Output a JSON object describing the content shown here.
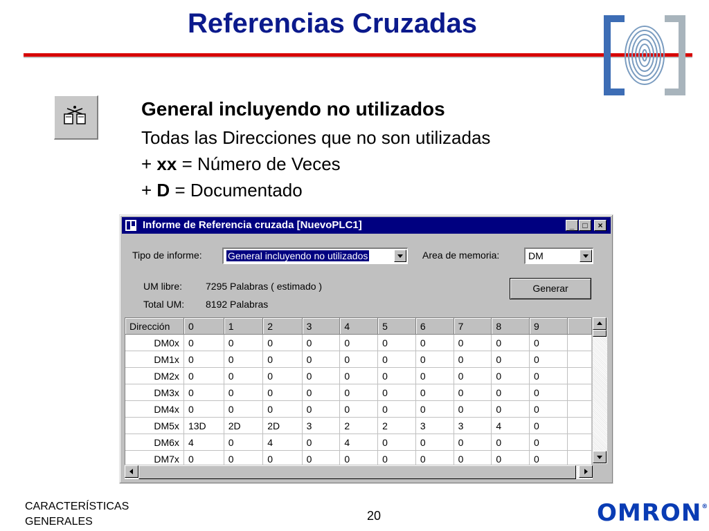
{
  "slide": {
    "title": "Referencias Cruzadas",
    "heading": "General incluyendo no utilizados",
    "line1": "Todas las Direcciones que no son utilizadas",
    "line2_prefix": "+",
    "line2_bold": "xx",
    "line2_rest": "= Número de Veces",
    "line3_prefix": "+",
    "line3_bold": "D",
    "line3_rest": "= Documentado"
  },
  "window": {
    "title": "Informe de Referencia cruzada [NuevoPLC1]",
    "report_type_label": "Tipo de informe:",
    "report_type_value": "General incluyendo no utilizados",
    "memory_area_label": "Area de memoria:",
    "memory_area_value": "DM",
    "um_free_label": "UM libre:",
    "um_free_value": "7295 Palabras ( estimado )",
    "um_total_label": "Total UM:",
    "um_total_value": "8192 Palabras",
    "generate_label": "Generar"
  },
  "table": {
    "headers": [
      "Dirección",
      "0",
      "1",
      "2",
      "3",
      "4",
      "5",
      "6",
      "7",
      "8",
      "9"
    ],
    "rows": [
      [
        "DM0x",
        "0",
        "0",
        "0",
        "0",
        "0",
        "0",
        "0",
        "0",
        "0",
        "0"
      ],
      [
        "DM1x",
        "0",
        "0",
        "0",
        "0",
        "0",
        "0",
        "0",
        "0",
        "0",
        "0"
      ],
      [
        "DM2x",
        "0",
        "0",
        "0",
        "0",
        "0",
        "0",
        "0",
        "0",
        "0",
        "0"
      ],
      [
        "DM3x",
        "0",
        "0",
        "0",
        "0",
        "0",
        "0",
        "0",
        "0",
        "0",
        "0"
      ],
      [
        "DM4x",
        "0",
        "0",
        "0",
        "0",
        "0",
        "0",
        "0",
        "0",
        "0",
        "0"
      ],
      [
        "DM5x",
        "13D",
        "2D",
        "2D",
        "3",
        "2",
        "2",
        "3",
        "3",
        "4",
        "0"
      ],
      [
        "DM6x",
        "4",
        "0",
        "4",
        "0",
        "4",
        "0",
        "0",
        "0",
        "0",
        "0"
      ],
      [
        "DM7x",
        "0",
        "0",
        "0",
        "0",
        "0",
        "0",
        "0",
        "0",
        "0",
        "0"
      ]
    ]
  },
  "footer": {
    "left_line1": "CARACTERÍSTICAS",
    "left_line2": "GENERALES",
    "page": "20",
    "brand": "OMRON",
    "brand_mark": "®"
  },
  "icons": [
    "fingerprint-logo-icon",
    "cross-reference-tool-icon",
    "window-app-icon",
    "minimize-icon",
    "maximize-icon",
    "close-icon",
    "dropdown-arrow-icon",
    "scroll-up-icon",
    "scroll-down-icon",
    "scroll-left-icon",
    "scroll-right-icon"
  ],
  "colors": {
    "title": "#0b1a8c",
    "rule": "#d60000",
    "titlebar": "#000080",
    "brand": "#0a3cb4"
  }
}
